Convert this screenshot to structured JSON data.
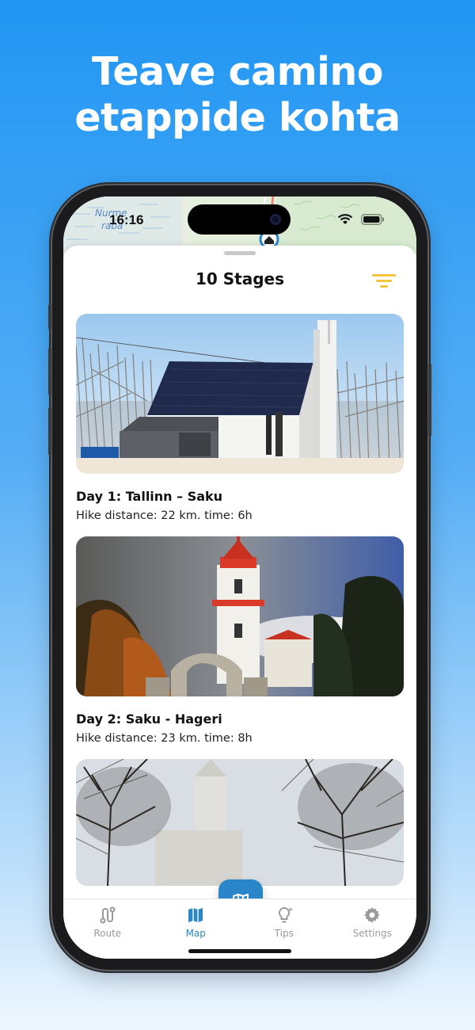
{
  "headline": {
    "line1": "Teave camino",
    "line2": "etappide kohta"
  },
  "status_bar": {
    "time": "16:16"
  },
  "map": {
    "labels": [
      "Nurme",
      "raba"
    ]
  },
  "sheet": {
    "title": "10 Stages"
  },
  "stages": [
    {
      "title": "Day 1: Tallinn – Saku",
      "subtitle": "Hike distance: 22 km. time: 6h"
    },
    {
      "title": "Day 2: Saku - Hageri",
      "subtitle": "Hike distance: 23 km. time: 8h"
    }
  ],
  "tabs": [
    {
      "label": "Route",
      "icon": "route-icon",
      "active": false
    },
    {
      "label": "Map",
      "icon": "map-icon",
      "active": true
    },
    {
      "label": "Tips",
      "icon": "lightbulb-icon",
      "active": false
    },
    {
      "label": "Settings",
      "icon": "gear-icon",
      "active": false
    }
  ],
  "colors": {
    "accent": "#2a86c9",
    "filter_icon": "#f5c53b",
    "background_top": "#2196f3"
  }
}
